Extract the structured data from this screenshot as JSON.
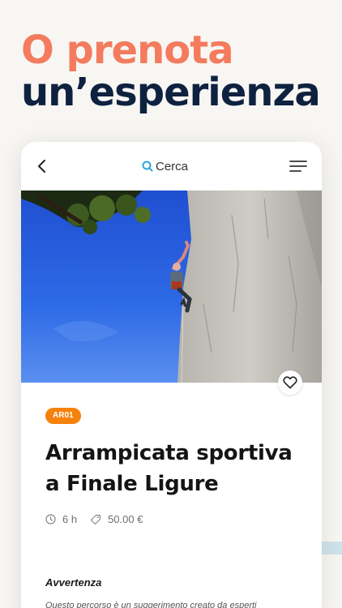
{
  "headline": {
    "line1": "O prenota",
    "line2": "un’esperienza"
  },
  "colors": {
    "headline_accent": "#f47b5e",
    "headline_dark": "#0e2240",
    "badge": "#f5820d",
    "search_icon": "#2aa6d8"
  },
  "header": {
    "back_icon": "chevron-left-icon",
    "search_label": "Cerca",
    "search_icon": "search-icon",
    "menu_icon": "hamburger-menu-icon"
  },
  "hero": {
    "favorite_icon": "heart-icon"
  },
  "experience": {
    "code": "AR01",
    "title_line1": "Arrampicata sportiva",
    "title_line2": "a Finale Ligure",
    "duration": "6 h",
    "duration_icon": "clock-icon",
    "price": "50.00 €",
    "price_icon": "tag-icon"
  },
  "warning": {
    "title": "Avvertenza",
    "text": "Questo percorso è un suggerimento creato da esperti"
  }
}
